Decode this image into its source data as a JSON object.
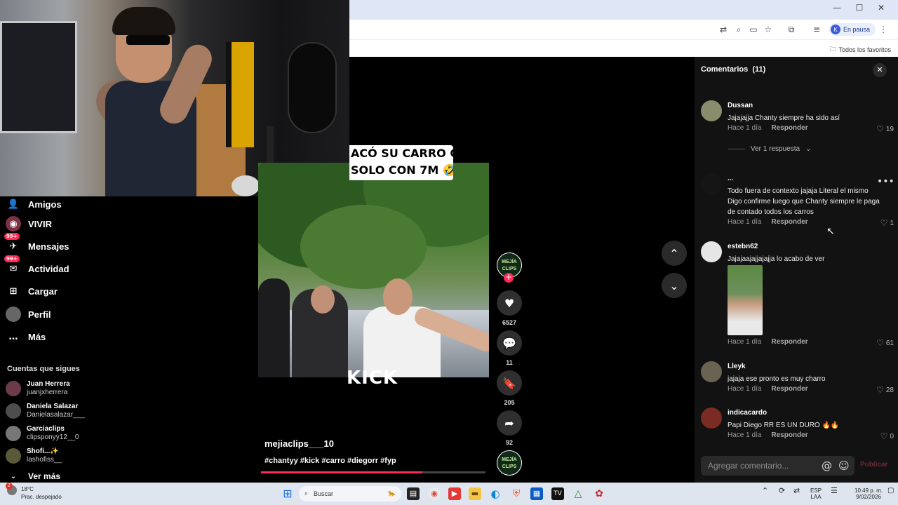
{
  "browser": {
    "window_controls": [
      "—",
      "☐",
      "✕"
    ],
    "profile_initial": "K",
    "profile_label": "En pausa",
    "bookmarks_label": "Todos los favoritos"
  },
  "sidebar": {
    "items": [
      {
        "label": "Amigos",
        "icon": "friends-icon",
        "badge": ""
      },
      {
        "label": "VIVIR",
        "icon": "live-icon",
        "badge": ""
      },
      {
        "label": "Mensajes",
        "icon": "messages-icon",
        "badge": "99+"
      },
      {
        "label": "Actividad",
        "icon": "activity-icon",
        "badge": "99+"
      },
      {
        "label": "Cargar",
        "icon": "upload-icon",
        "badge": ""
      },
      {
        "label": "Perfil",
        "icon": "profile-icon",
        "badge": ""
      },
      {
        "label": "Más",
        "icon": "more-icon",
        "badge": ""
      }
    ],
    "following_title": "Cuentas que sigues",
    "following": [
      {
        "name": "Juan Herrera",
        "handle": "juanjxherrera"
      },
      {
        "name": "Daniela Salazar",
        "handle": "Danielasalazar___"
      },
      {
        "name": "Garciaclips",
        "handle": "clipsponyy12__0"
      },
      {
        "name": "Shofi...✨",
        "handle": "lashofiss__"
      }
    ],
    "see_more": "Ver más"
  },
  "video": {
    "caption_line1": "ACÓ SU CARRO CON",
    "caption_line2": "SOLO CON 7M 🤣",
    "watermark": "KICK",
    "author": "mejiaclips___10",
    "hashtags": "#chantyy #kick #carro #diegorr #fyp",
    "progress": 0.72
  },
  "actions": {
    "avatar_text": "MEJÍA CLIPS",
    "likes": "6527",
    "comments": "11",
    "saves": "205",
    "shares": "92"
  },
  "comments_panel": {
    "title": "Comentarios",
    "count": "(11)",
    "reply_label": "Responder",
    "view_replies": "Ver 1 respuesta",
    "input_placeholder": "Agregar comentario...",
    "publish": "Publicar",
    "items": [
      {
        "user": "Dussan",
        "text": "Jajajajja Chanty siempre ha sido así",
        "time": "Hace 1 día",
        "likes": "19"
      },
      {
        "user": "...",
        "text": "Todo fuera de contexto jajaja Literal el mismo Digo confirme luego que Chanty siempre le paga de contado todos los carros",
        "time": "Hace 1 día",
        "likes": "1"
      },
      {
        "user": "estebn62",
        "text": "Jajajaajajjajajja lo acabo de ver",
        "time": "Hace 1 día",
        "likes": "61"
      },
      {
        "user": "Lleyk",
        "text": "jajaja ese pronto es muy charro",
        "time": "Hace 1 día",
        "likes": "28"
      },
      {
        "user": "indicacardo",
        "text": "Papi Diego RR ES UN DURO 🔥🔥",
        "time": "Hace 1 día",
        "likes": "0"
      }
    ]
  },
  "taskbar": {
    "weather_badge": "2",
    "temperature": "18°C",
    "weather_text": "Prac. despejado",
    "search": "Buscar",
    "lang_top": "ESP",
    "lang_bottom": "LAA",
    "time": "10:49 p. m.",
    "date": "9/02/2026"
  },
  "colors": {
    "accent": "#fe2c55",
    "panel": "#121212",
    "taskbar": "#dfe5ee"
  }
}
